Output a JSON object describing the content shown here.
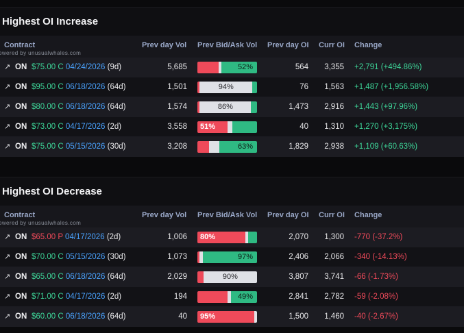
{
  "watermark": "owered by unusualwhales.com",
  "columns": {
    "contract": "Contract",
    "prev_vol": "Prev day Vol",
    "bid_ask": "Prev Bid/Ask Vol",
    "prev_oi": "Prev day OI",
    "curr_oi": "Curr OI",
    "change": "Change"
  },
  "colors": {
    "bid": "#ef4a5a",
    "mid": "#dfe1e6",
    "ask": "#2fba83",
    "call_strike": "#3dd598",
    "put_strike": "#ef4a5a",
    "expiry": "#4aa3ff"
  },
  "icons": {
    "row_link": "external-link-arrow-icon"
  },
  "increase": {
    "title": "Highest OI Increase",
    "rows": [
      {
        "arrow": "↗",
        "ticker": "ON",
        "strike": "$75.00 C",
        "type": "call",
        "expiry": "04/24/2026",
        "dte": "(9d)",
        "prev_vol": "5,685",
        "bid": 0.36,
        "mid": 0.04,
        "ask": 0.6,
        "bidask_label": "52%",
        "label_side": "ask",
        "prev_oi": "564",
        "curr_oi": "3,355",
        "change": "+2,791 (+494.86%)",
        "dir": "pos"
      },
      {
        "arrow": "↗",
        "ticker": "ON",
        "strike": "$95.00 C",
        "type": "call",
        "expiry": "06/18/2026",
        "dte": "(64d)",
        "prev_vol": "1,501",
        "bid": 0.04,
        "mid": 0.88,
        "ask": 0.08,
        "bidask_label": "94%",
        "label_side": "mid",
        "prev_oi": "76",
        "curr_oi": "1,563",
        "change": "+1,487 (+1,956.58%)",
        "dir": "pos"
      },
      {
        "arrow": "↗",
        "ticker": "ON",
        "strike": "$80.00 C",
        "type": "call",
        "expiry": "06/18/2026",
        "dte": "(64d)",
        "prev_vol": "1,574",
        "bid": 0.04,
        "mid": 0.86,
        "ask": 0.1,
        "bidask_label": "86%",
        "label_side": "mid",
        "prev_oi": "1,473",
        "curr_oi": "2,916",
        "change": "+1,443 (+97.96%)",
        "dir": "pos"
      },
      {
        "arrow": "↗",
        "ticker": "ON",
        "strike": "$73.00 C",
        "type": "call",
        "expiry": "04/17/2026",
        "dte": "(2d)",
        "prev_vol": "3,558",
        "bid": 0.51,
        "mid": 0.08,
        "ask": 0.41,
        "bidask_label": "51%",
        "label_side": "bid",
        "prev_oi": "40",
        "curr_oi": "1,310",
        "change": "+1,270 (+3,175%)",
        "dir": "pos"
      },
      {
        "arrow": "↗",
        "ticker": "ON",
        "strike": "$75.00 C",
        "type": "call",
        "expiry": "05/15/2026",
        "dte": "(30d)",
        "prev_vol": "3,208",
        "bid": 0.19,
        "mid": 0.18,
        "ask": 0.63,
        "bidask_label": "63%",
        "label_side": "ask",
        "prev_oi": "1,829",
        "curr_oi": "2,938",
        "change": "+1,109 (+60.63%)",
        "dir": "pos"
      }
    ]
  },
  "decrease": {
    "title": "Highest OI Decrease",
    "rows": [
      {
        "arrow": "↗",
        "ticker": "ON",
        "strike": "$65.00 P",
        "type": "put",
        "expiry": "04/17/2026",
        "dte": "(2d)",
        "prev_vol": "1,006",
        "bid": 0.8,
        "mid": 0.05,
        "ask": 0.15,
        "bidask_label": "80%",
        "label_side": "bid",
        "prev_oi": "2,070",
        "curr_oi": "1,300",
        "change": "-770 (-37.2%)",
        "dir": "neg"
      },
      {
        "arrow": "↗",
        "ticker": "ON",
        "strike": "$70.00 C",
        "type": "call",
        "expiry": "05/15/2026",
        "dte": "(30d)",
        "prev_vol": "1,073",
        "bid": 0.03,
        "mid": 0.06,
        "ask": 0.91,
        "bidask_label": "97%",
        "label_side": "ask",
        "prev_oi": "2,406",
        "curr_oi": "2,066",
        "change": "-340 (-14.13%)",
        "dir": "neg"
      },
      {
        "arrow": "↗",
        "ticker": "ON",
        "strike": "$65.00 C",
        "type": "call",
        "expiry": "06/18/2026",
        "dte": "(64d)",
        "prev_vol": "2,029",
        "bid": 0.1,
        "mid": 0.9,
        "ask": 0.0,
        "bidask_label": "90%",
        "label_side": "mid",
        "prev_oi": "3,807",
        "curr_oi": "3,741",
        "change": "-66 (-1.73%)",
        "dir": "neg"
      },
      {
        "arrow": "↗",
        "ticker": "ON",
        "strike": "$71.00 C",
        "type": "call",
        "expiry": "04/17/2026",
        "dte": "(2d)",
        "prev_vol": "194",
        "bid": 0.5,
        "mid": 0.06,
        "ask": 0.44,
        "bidask_label": "49%",
        "label_side": "ask",
        "prev_oi": "2,841",
        "curr_oi": "2,782",
        "change": "-59 (-2.08%)",
        "dir": "neg"
      },
      {
        "arrow": "↗",
        "ticker": "ON",
        "strike": "$60.00 C",
        "type": "call",
        "expiry": "06/18/2026",
        "dte": "(64d)",
        "prev_vol": "40",
        "bid": 0.95,
        "mid": 0.05,
        "ask": 0.0,
        "bidask_label": "95%",
        "label_side": "bid",
        "prev_oi": "1,500",
        "curr_oi": "1,460",
        "change": "-40 (-2.67%)",
        "dir": "neg"
      }
    ]
  }
}
